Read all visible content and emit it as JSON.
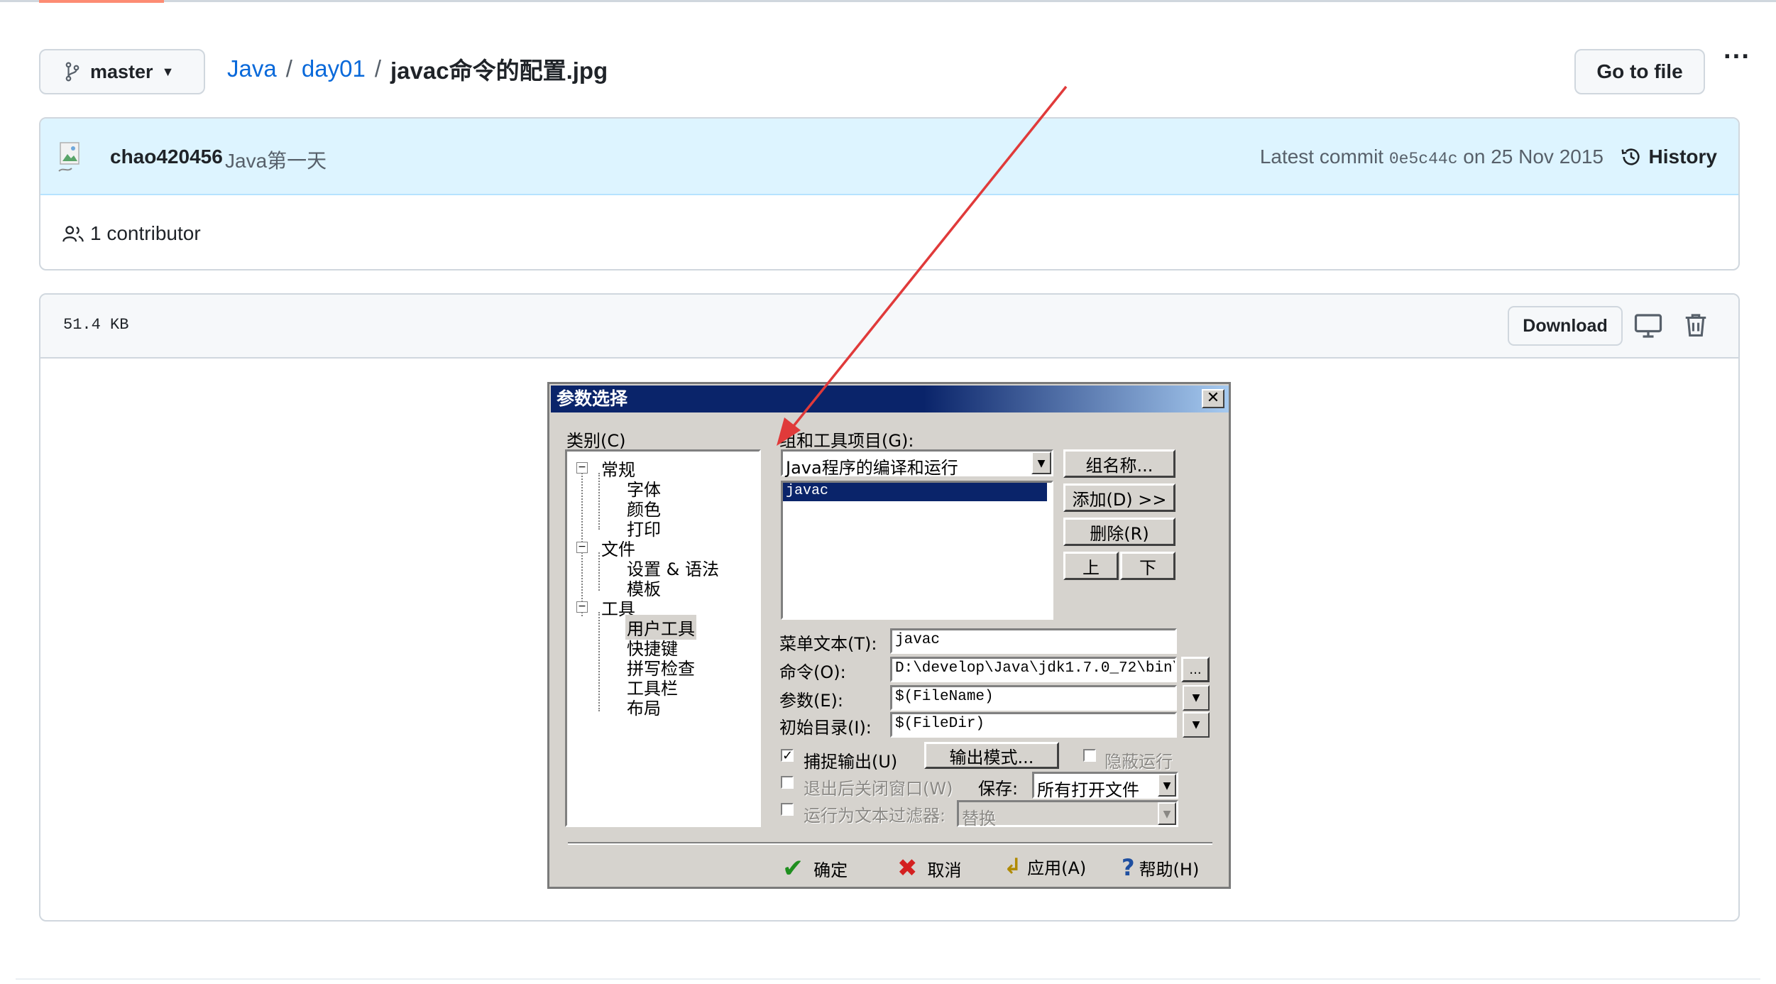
{
  "header": {
    "branch": "master",
    "breadcrumb": [
      "Java",
      "day01"
    ],
    "file_name": "javac命令的配置.jpg",
    "go_to_file": "Go to file",
    "more": "···"
  },
  "commit": {
    "author": "chao420456",
    "message": "Java第一天",
    "latest_label": "Latest commit",
    "hash": "0e5c44c",
    "date": "on 25 Nov 2015",
    "history": "History",
    "contributors": "1 contributor"
  },
  "file": {
    "size": "51.4 KB",
    "download": "Download"
  },
  "dialog": {
    "title": "参数选择",
    "close": "✕",
    "category_label": "类别(C)",
    "tree": [
      {
        "label": "常规",
        "level": 0,
        "box": "−"
      },
      {
        "label": "字体",
        "level": 1
      },
      {
        "label": "颜色",
        "level": 1
      },
      {
        "label": "打印",
        "level": 1
      },
      {
        "label": "文件",
        "level": 0,
        "box": "−"
      },
      {
        "label": "设置 & 语法",
        "level": 1
      },
      {
        "label": "模板",
        "level": 1
      },
      {
        "label": "工具",
        "level": 0,
        "box": "−"
      },
      {
        "label": "用户工具",
        "level": 1
      },
      {
        "label": "快捷键",
        "level": 1
      },
      {
        "label": "拼写检查",
        "level": 1
      },
      {
        "label": "工具栏",
        "level": 1
      },
      {
        "label": "布局",
        "level": 1
      }
    ],
    "group_label": "组和工具项目(G):",
    "group_value": "Java程序的编译和运行",
    "list_item": "javac",
    "btn_group_name": "组名称...",
    "btn_add": "添加(D) >>",
    "btn_delete": "删除(R)",
    "btn_up": "上",
    "btn_down": "下",
    "menu_text_label": "菜单文本(T):",
    "menu_text_value": "javac",
    "command_label": "命令(O):",
    "command_value": "D:\\develop\\Java\\jdk1.7.0_72\\bin\\j",
    "browse": "...",
    "params_label": "参数(E):",
    "params_value": "$(FileName)",
    "dir_label": "初始目录(I):",
    "dir_value": "$(FileDir)",
    "capture_output": "捕捉输出(U)",
    "output_mode": "输出模式...",
    "hide_run": "隐蔽运行",
    "close_on_exit": "退出后关闭窗口(W)",
    "save_label": "保存:",
    "save_value": "所有打开文件",
    "run_as_filter": "运行为文本过滤器:",
    "replace_value": "替换",
    "ok": "确定",
    "cancel": "取消",
    "apply": "应用(A)",
    "help": "帮助(H)"
  }
}
